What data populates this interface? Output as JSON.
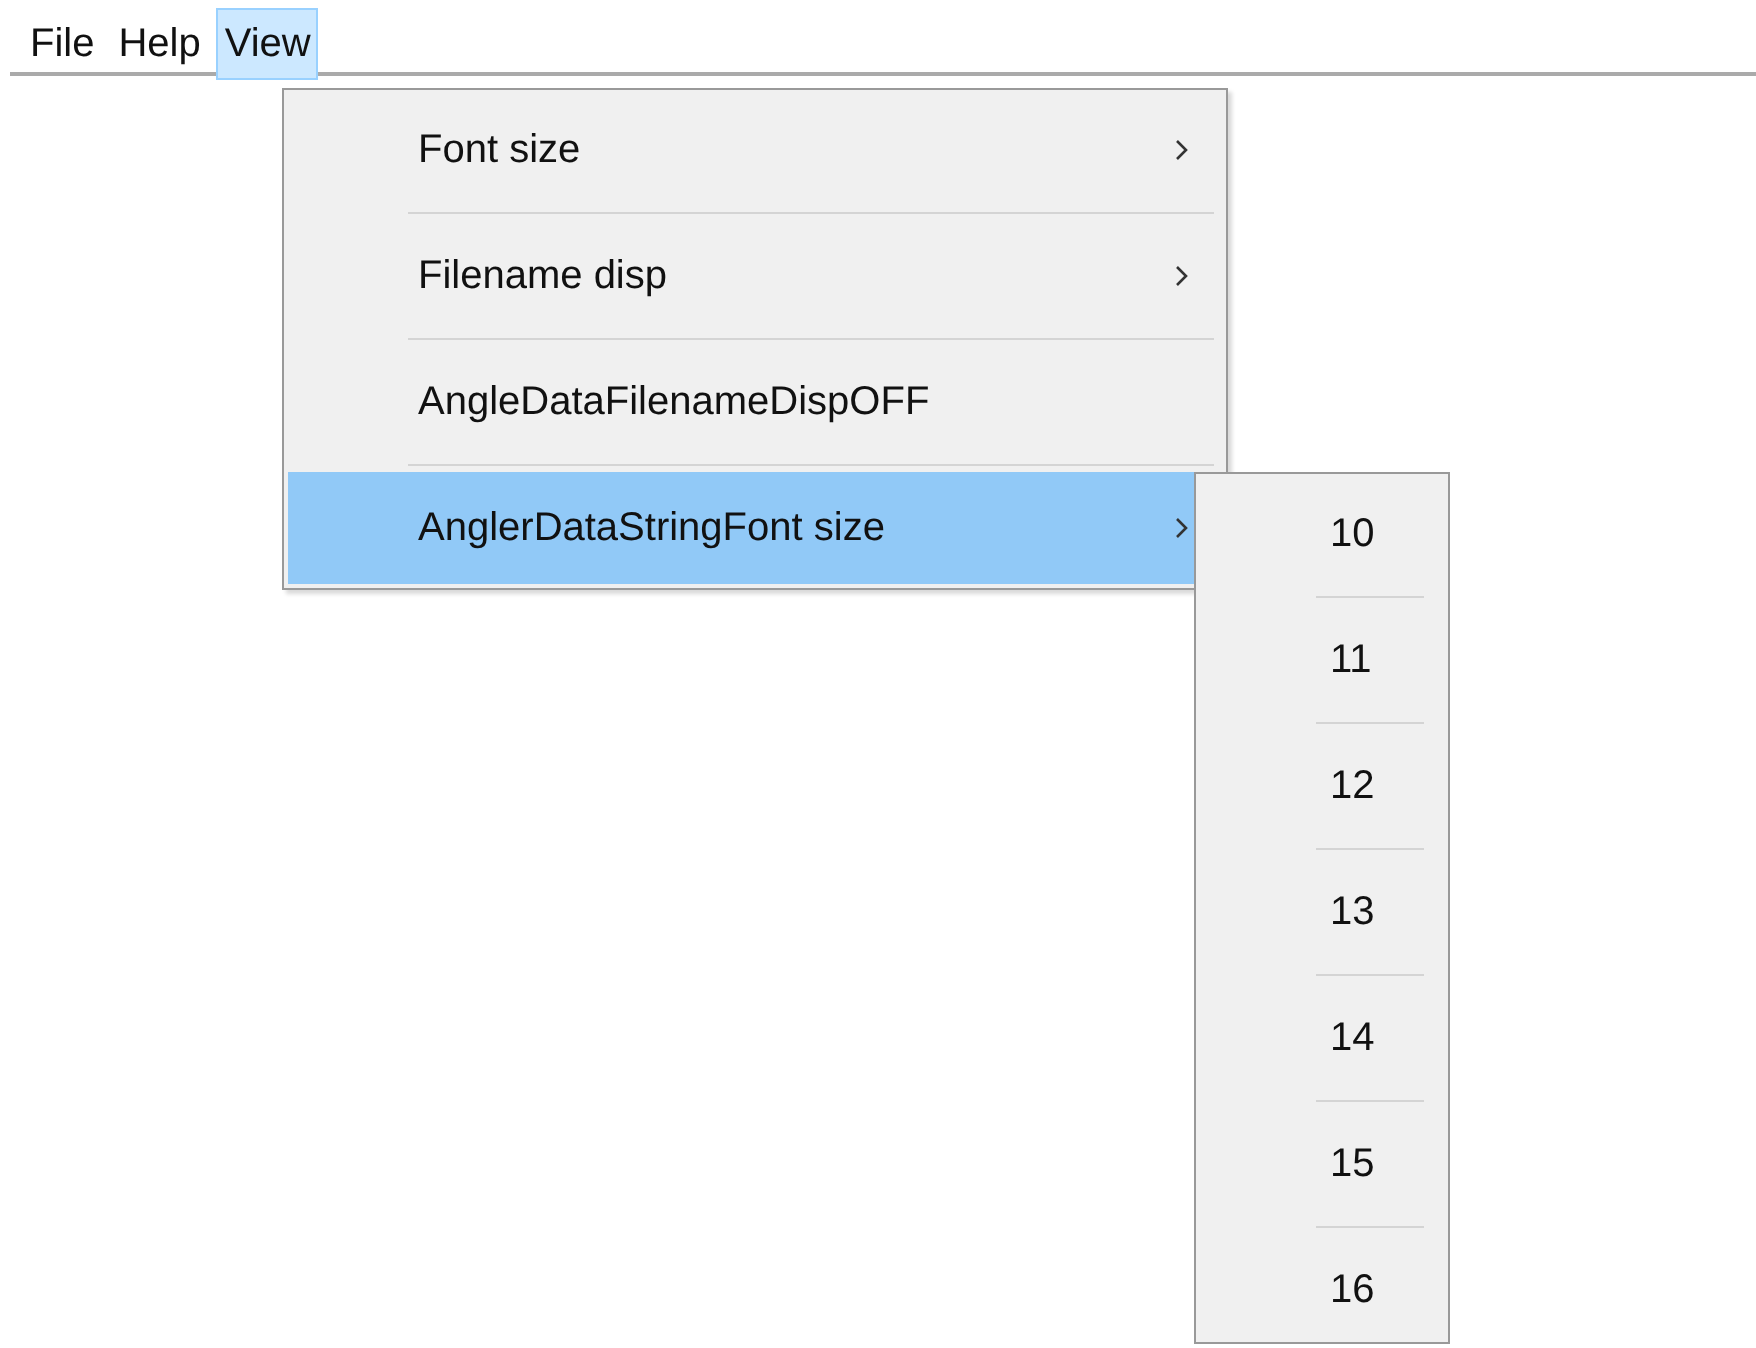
{
  "menubar": [
    {
      "label": "File",
      "selected": false
    },
    {
      "label": "Help",
      "selected": false
    },
    {
      "label": "View",
      "selected": true
    }
  ],
  "view_menu": [
    {
      "label": "Font size",
      "submenu": true,
      "selected": false
    },
    {
      "label": "Filename disp",
      "submenu": true,
      "selected": false
    },
    {
      "label": "AngleDataFilenameDispOFF",
      "submenu": false,
      "selected": false
    },
    {
      "label": "AnglerDataStringFont size",
      "submenu": true,
      "selected": true
    }
  ],
  "font_size_submenu": [
    {
      "label": "10"
    },
    {
      "label": "11"
    },
    {
      "label": "12"
    },
    {
      "label": "13"
    },
    {
      "label": "14"
    },
    {
      "label": "15"
    },
    {
      "label": "16"
    }
  ]
}
